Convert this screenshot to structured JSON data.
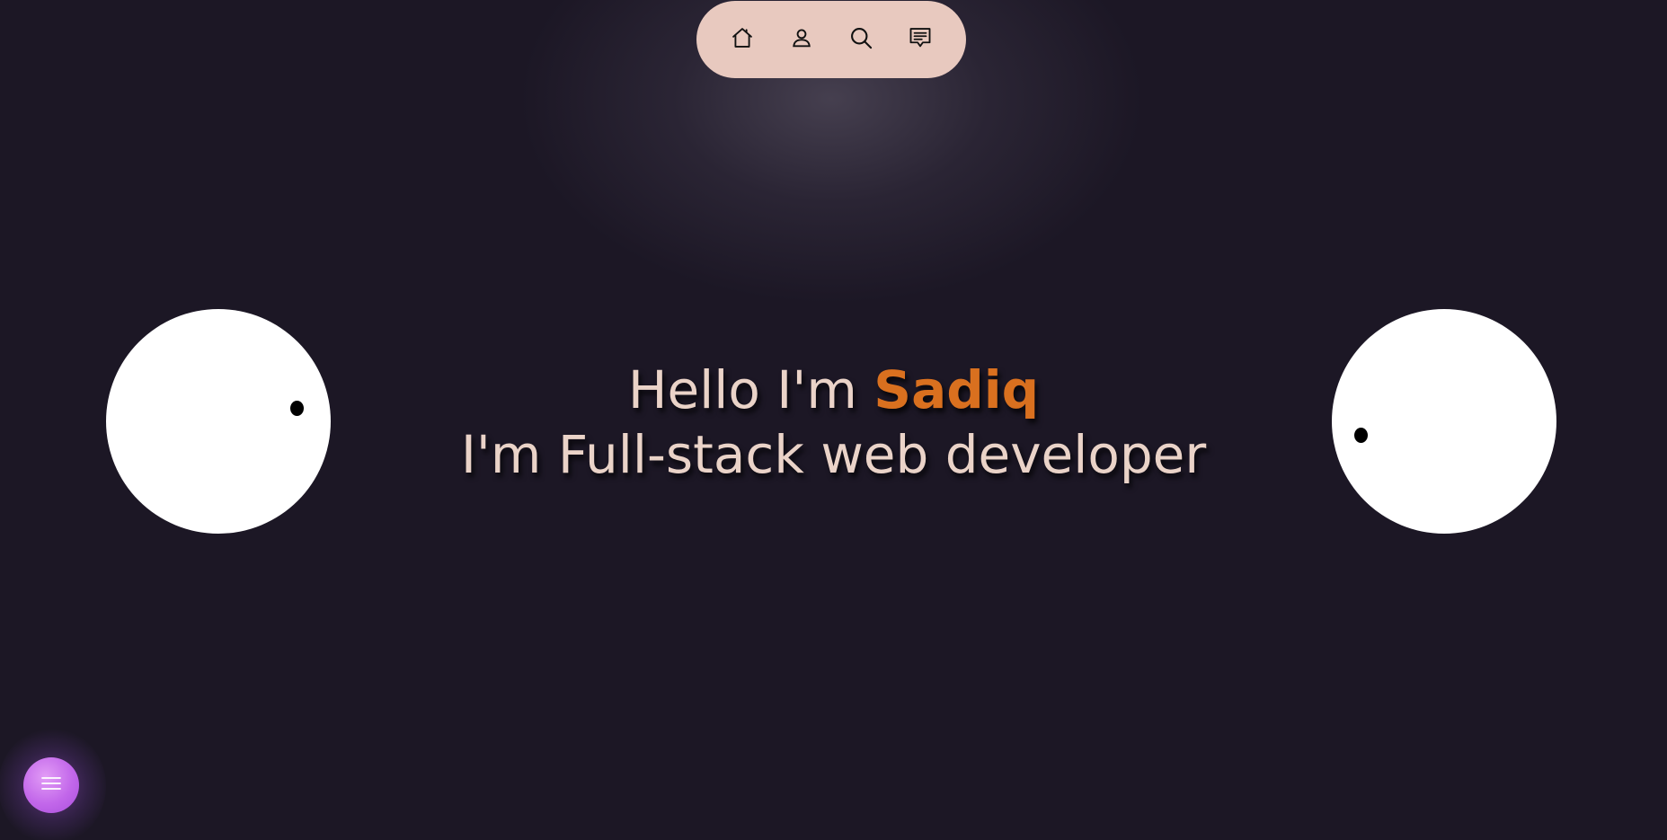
{
  "nav": {
    "items": [
      {
        "icon": "home-icon"
      },
      {
        "icon": "user-icon"
      },
      {
        "icon": "search-icon"
      },
      {
        "icon": "chat-icon"
      }
    ],
    "background": "#e8c9bf"
  },
  "hero": {
    "greeting_prefix": "Hello I'm ",
    "name": "Sadiq",
    "tagline": "I'm Full-stack web developer",
    "text_color": "#ead3c8",
    "name_color": "#d9701f"
  },
  "menu_fab": {
    "icon": "hamburger-icon",
    "color": "#c267ea"
  },
  "theme": {
    "background": "#1c1725",
    "eye_color": "#ffffff",
    "pupil_color": "#000000"
  }
}
